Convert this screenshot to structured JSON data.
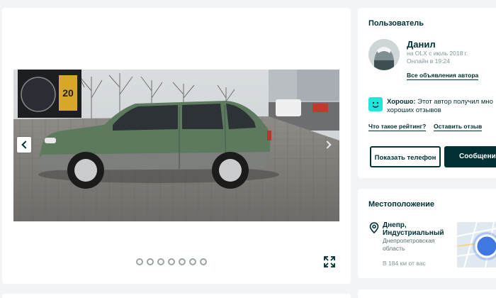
{
  "user": {
    "title": "Пользователь",
    "name": "Данил",
    "member_since": "на OLX с июль 2018 г.",
    "online": "Онлайн в 19:24",
    "all_ads_link": "Все объявления автора",
    "rating_good": "Хорошо:",
    "rating_text_line1": "Этот автор получил мно",
    "rating_text_line2": "хороших отзывов",
    "what_is_rating_link": "Что такое рейтинг?",
    "leave_review_link": "Оставить отзыв",
    "phone_button": "Показать телефон",
    "message_button": "Сообщени"
  },
  "location": {
    "title": "Местоположение",
    "city": "Днепр, Индустриальный",
    "region": "Днепропетровская область",
    "distance": "В 184 км от вас"
  },
  "gallery": {
    "dots_count": 7,
    "icons": [
      "chevron-left-icon",
      "chevron-right-icon",
      "expand-icon",
      "map-pin-icon",
      "smile-icon"
    ]
  },
  "colors": {
    "brand_dark": "#002f34",
    "accent_teal": "#23e5db",
    "muted": "#7f9799",
    "background": "#f2f4f5"
  }
}
